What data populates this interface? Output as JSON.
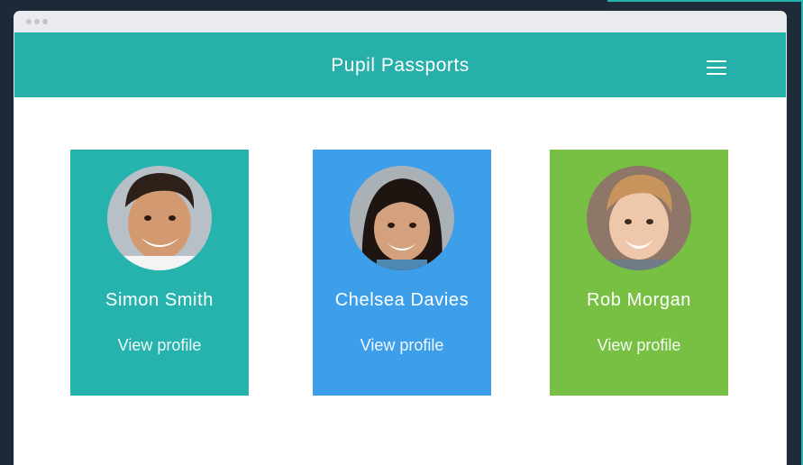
{
  "app": {
    "title": "Pupil Passports"
  },
  "colors": {
    "appbar": "#27b0aa",
    "card1": "#26b3ad",
    "card2": "#3d9fea",
    "card3": "#78c043"
  },
  "icons": {
    "menu": "hamburger-menu-icon",
    "avatar": "avatar-photo"
  },
  "pupils": [
    {
      "name": "Simon Smith",
      "link": "View profile"
    },
    {
      "name": "Chelsea Davies",
      "link": "View profile"
    },
    {
      "name": "Rob Morgan",
      "link": "View profile"
    }
  ]
}
